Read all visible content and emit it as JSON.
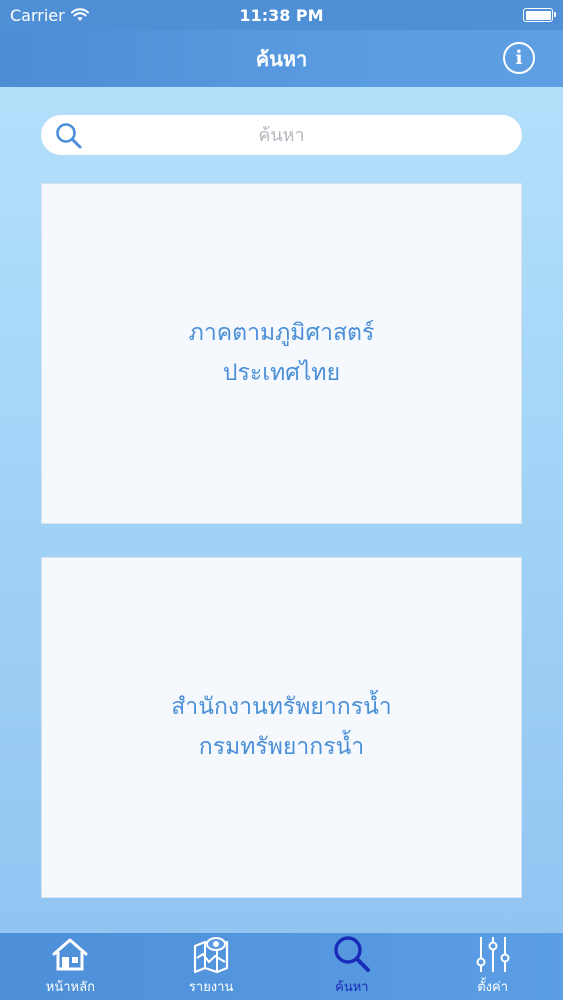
{
  "status": {
    "carrier": "Carrier",
    "time": "11:38 PM"
  },
  "nav": {
    "title": "ค้นหา",
    "info_label": "i"
  },
  "search": {
    "placeholder": "ค้นหา",
    "value": ""
  },
  "cards": [
    {
      "line1": "ภาคตามภูมิศาสตร์",
      "line2": "ประเทศไทย"
    },
    {
      "line1": "สำนักงานทรัพยากรน้ำ",
      "line2": "กรมทรัพยากรน้ำ"
    }
  ],
  "tabs": [
    {
      "label": "หน้าหลัก",
      "icon": "home-icon",
      "active": false
    },
    {
      "label": "รายงาน",
      "icon": "map-report-icon",
      "active": false
    },
    {
      "label": "ค้นหา",
      "icon": "search-icon",
      "active": true
    },
    {
      "label": "ตั้งค่า",
      "icon": "sliders-icon",
      "active": false
    }
  ],
  "colors": {
    "nav_bg": "#4f8fd6",
    "card_text": "#4a8fd8",
    "active_tab": "#1a2bb8"
  }
}
